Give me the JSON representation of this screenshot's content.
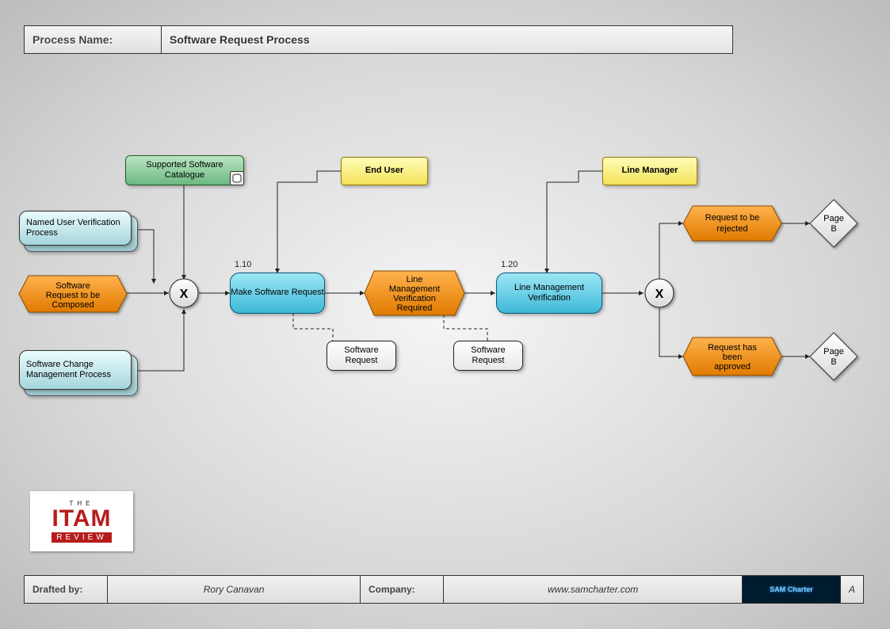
{
  "header": {
    "label": "Process Name:",
    "value": "Software Request Process"
  },
  "footer": {
    "label1": "Drafted by:",
    "value1": "Rory Canavan",
    "label2": "Company:",
    "value2": "www.samcharter.com",
    "logo": "SAM Charter",
    "page": "A"
  },
  "logo": {
    "line1": "THE",
    "big": "ITAM",
    "line3": "REVIEW"
  },
  "roles": {
    "end_user": "End User",
    "line_manager": "Line Manager"
  },
  "catalogue": "Supported Software Catalogue",
  "inputs": {
    "named_user": "Named User Verification Process",
    "compose_hex": "Software Request to be Composed",
    "change_mgmt": "Software Change Management Process"
  },
  "gateway": {
    "x1": "X",
    "x2": "X"
  },
  "steps": {
    "make_request": {
      "id": "1.10",
      "label": "Make Software Request"
    },
    "verification": {
      "id": "1.20",
      "label": "Line Management Verification"
    }
  },
  "hexes": {
    "verif_required": "Line Management Verification Required",
    "reject": "Request to be rejected",
    "approve": "Request has been approved"
  },
  "objects": {
    "sr1": "Software Request",
    "sr2": "Software Request"
  },
  "pages": {
    "b1": "Page B",
    "b2": "Page B"
  }
}
